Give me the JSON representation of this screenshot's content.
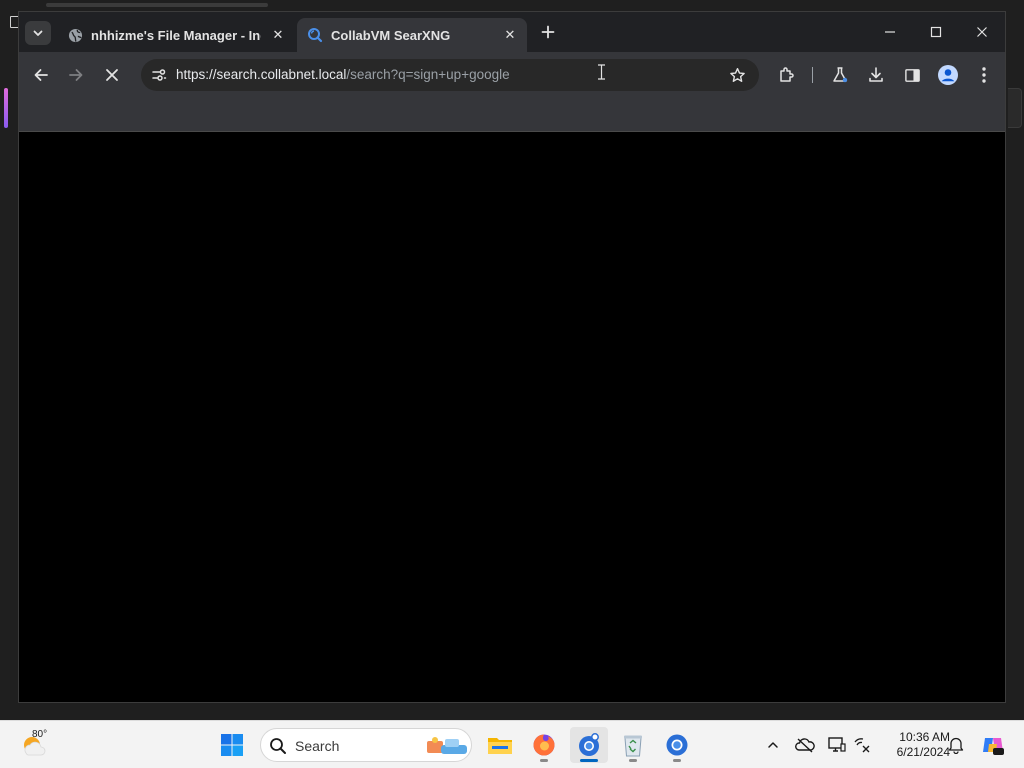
{
  "browser": {
    "tabs": [
      {
        "title": "nhhizme's File Manager - Index",
        "active": false,
        "favicon": "globe-icon"
      },
      {
        "title": "CollabVM SearXNG",
        "active": true,
        "favicon": "searxng-icon"
      }
    ],
    "address_bar": {
      "host": "https://search.collabnet.local",
      "path": "/search?q=sign+up+google",
      "loading": true
    },
    "toolbar_icons": [
      "back-icon",
      "forward-icon",
      "stop-loading-icon",
      "site-info-icon",
      "bookmark-star-icon",
      "extensions-icon",
      "labs-icon",
      "download-icon",
      "side-panel-icon",
      "profile-icon",
      "more-menu-icon"
    ],
    "window_controls": [
      "minimize-icon",
      "maximize-icon",
      "close-icon"
    ]
  },
  "taskbar": {
    "weather": {
      "temp": "80°",
      "icon": "weather-sun-cloud-icon"
    },
    "search": {
      "placeholder": "Search"
    },
    "pinned_apps": [
      "start-icon",
      "file-explorer-icon",
      "firefox-icon",
      "chrome-canary-icon",
      "recycle-bin-icon",
      "chrome-icon"
    ],
    "tray": [
      "chevron-up-icon",
      "onedrive-icon",
      "display-icon",
      "accessibility-icon",
      "notification-bell-icon",
      "copilot-icon"
    ],
    "clock": {
      "time": "10:36 AM",
      "date": "6/21/2024"
    }
  }
}
